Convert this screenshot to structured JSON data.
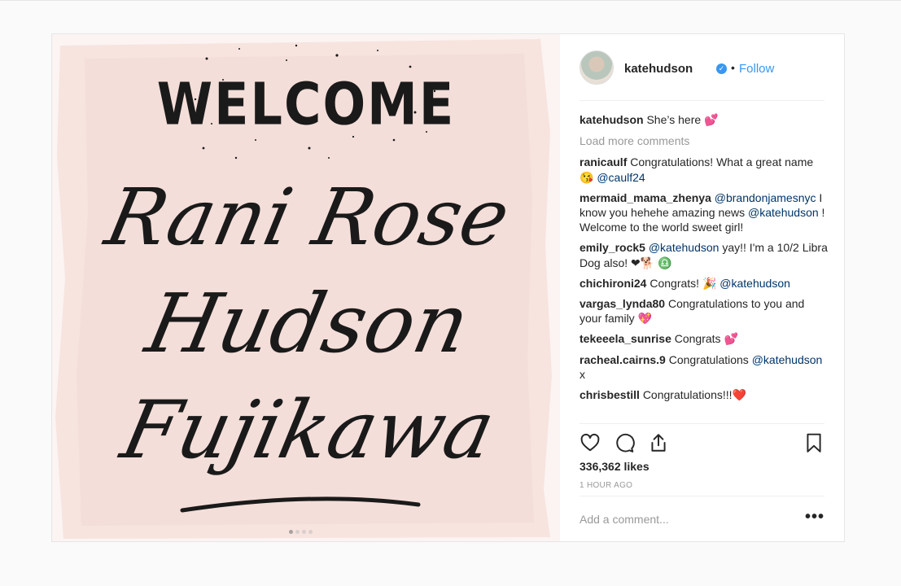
{
  "post": {
    "image_text": {
      "line1": "WELCOME",
      "line2": "Rani Rose",
      "line3": "Hudson",
      "line4": "Fujikawa"
    },
    "carousel_dots": 4
  },
  "header": {
    "username": "katehudson",
    "verified_icon": "verified-check-icon",
    "separator": "•",
    "follow_label": "Follow"
  },
  "caption": {
    "user": "katehudson",
    "text": "She’s here 💕"
  },
  "load_more": "Load more comments",
  "comments": [
    {
      "user": "ranicaulf",
      "text": "Congratulations! What a great name 😘 ",
      "mention": "@caulf24",
      "after": ""
    },
    {
      "user": "mermaid_mama_zhenya",
      "text": "",
      "mention": "@brandonjamesnyc",
      "after": " I know you hehehe amazing news ",
      "mention2": "@katehudson",
      "after2": " ! Welcome to the world sweet girl!"
    },
    {
      "user": "emily_rock5",
      "text": "",
      "mention": "@katehudson",
      "after": " yay!! I'm a 10/2 Libra Dog also! ❤🐕 ♎"
    },
    {
      "user": "chichironi24",
      "text": "Congrats! 🎉 ",
      "mention": "@katehudson",
      "after": ""
    },
    {
      "user": "vargas_lynda80",
      "text": "Congratulations to you and your family 💖",
      "mention": "",
      "after": ""
    },
    {
      "user": "tekeeela_sunrise",
      "text": "Congrats 💕",
      "mention": "",
      "after": ""
    },
    {
      "user": "racheal.cairns.9",
      "text": "Congratulations ",
      "mention": "@katehudson",
      "after": " x"
    },
    {
      "user": "chrisbestill",
      "text": "Congratulations!!!❤️",
      "mention": "",
      "after": ""
    }
  ],
  "actions": {
    "like_icon": "heart-icon",
    "comment_icon": "comment-bubble-icon",
    "share_icon": "share-icon",
    "save_icon": "bookmark-icon"
  },
  "likes": "336,362 likes",
  "time": "1 HOUR AGO",
  "add_comment": {
    "placeholder": "Add a comment...",
    "more": "•••"
  },
  "colors": {
    "link": "#3897f0",
    "mention": "#003569",
    "muted": "#999999",
    "media_bg": "#fbf4f2",
    "wash": "#f3d9d3"
  }
}
